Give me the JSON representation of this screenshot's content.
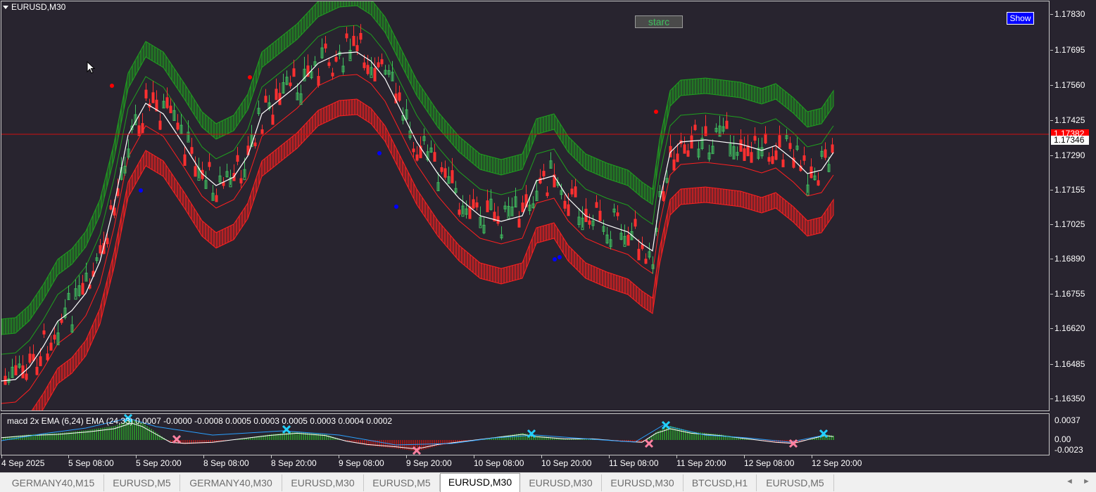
{
  "window": {
    "symbol_title": "EURUSD,M30",
    "starc_button": "starc",
    "show_button": "Show",
    "current_price": "1.17346",
    "hline_price": "1.17382",
    "colors": {
      "background": "#28242f",
      "bull_candle": "#3fbf5f",
      "bear_candle": "#ff3030",
      "upper_band": "#1fa01f",
      "lower_band": "#ff2020",
      "middle_line": "#ffffff",
      "price_line": "#d01010"
    }
  },
  "price_scale": {
    "labels": [
      "1.17830",
      "1.17695",
      "1.17560",
      "1.17425",
      "1.17290",
      "1.17155",
      "1.17025",
      "1.16890",
      "1.16755",
      "1.16620",
      "1.16485",
      "1.16350"
    ]
  },
  "indicator": {
    "label": "macd 2x EMA (6,24) EMA (24,33)  0.0007 -0.0000 -0.0008 0.0005 0.0003 0.0005 0.0003 0.0004 0.0002",
    "scale_labels": [
      "0.0037",
      "0.00",
      "-0.0023"
    ]
  },
  "time_axis": {
    "labels": [
      "4 Sep 2025",
      "5 Sep 08:00",
      "5 Sep 20:00",
      "8 Sep 08:00",
      "8 Sep 20:00",
      "9 Sep 08:00",
      "9 Sep 20:00",
      "10 Sep 08:00",
      "10 Sep 20:00",
      "11 Sep 08:00",
      "11 Sep 20:00",
      "12 Sep 08:00",
      "12 Sep 20:00"
    ]
  },
  "tabs": [
    {
      "label": "GERMANY40,M15",
      "active": false
    },
    {
      "label": "EURUSD,M5",
      "active": false
    },
    {
      "label": "GERMANY40,M30",
      "active": false
    },
    {
      "label": "EURUSD,M30",
      "active": false
    },
    {
      "label": "EURUSD,M5",
      "active": false
    },
    {
      "label": "EURUSD,M30",
      "active": true
    },
    {
      "label": "EURUSD,M30",
      "active": false
    },
    {
      "label": "EURUSD,M30",
      "active": false
    },
    {
      "label": "BTCUSD,H1",
      "active": false
    },
    {
      "label": "EURUSD,M5",
      "active": false
    }
  ],
  "tab_scroll": {
    "left": "◄",
    "right": "►"
  }
}
